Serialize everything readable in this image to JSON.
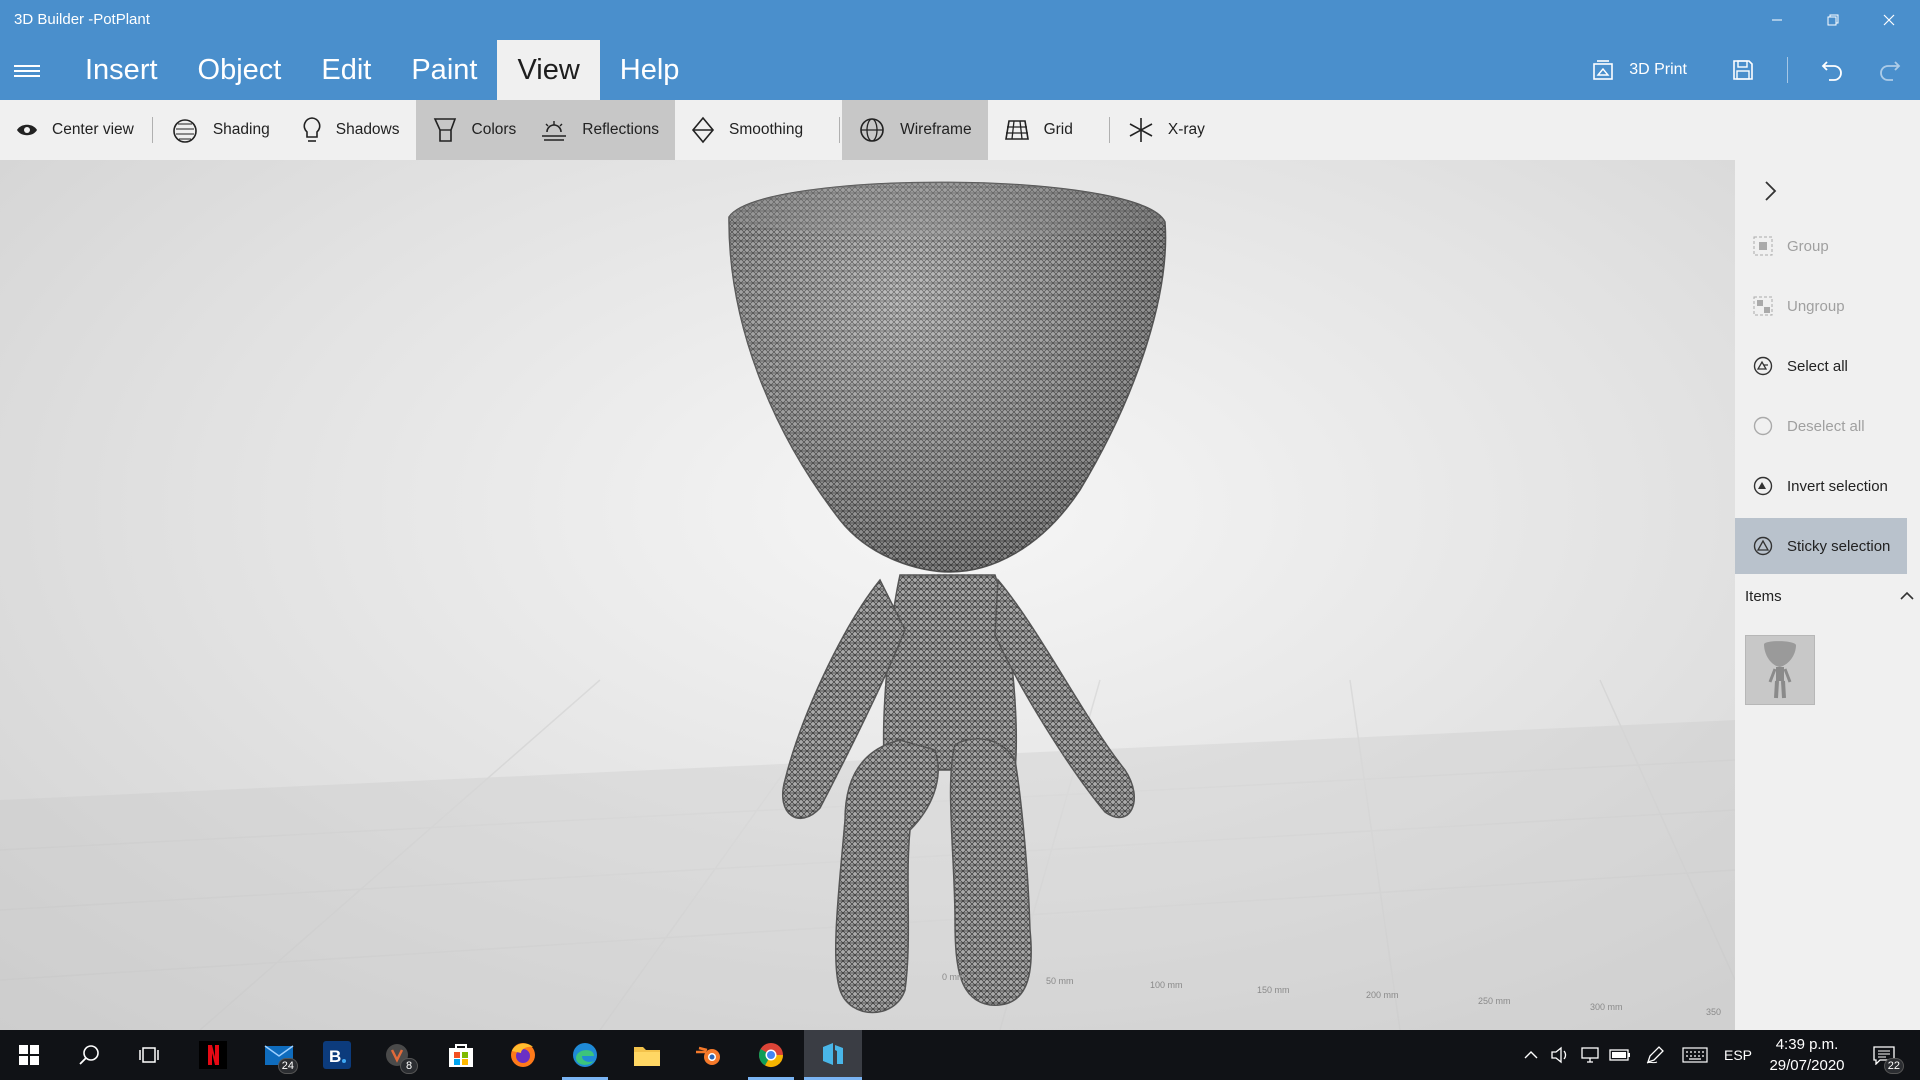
{
  "app": {
    "title": "3D Builder -PotPlant"
  },
  "menu": [
    {
      "label": "Insert"
    },
    {
      "label": "Object"
    },
    {
      "label": "Edit"
    },
    {
      "label": "Paint"
    },
    {
      "label": "View",
      "active": true
    },
    {
      "label": "Help"
    }
  ],
  "toolbar": {
    "print_label": "3D Print",
    "icons": [
      "print-3d-icon",
      "save-icon",
      "undo-icon",
      "redo-icon"
    ]
  },
  "ribbon": [
    {
      "label": "Center view",
      "icon": "eye-icon",
      "active": false
    },
    {
      "label": "Shading",
      "icon": "shading-icon",
      "active": false
    },
    {
      "label": "Shadows",
      "icon": "bulb-icon",
      "active": false
    },
    {
      "label": "Colors",
      "icon": "paint-bucket-icon",
      "active": true
    },
    {
      "label": "Reflections",
      "icon": "reflection-icon",
      "active": true
    },
    {
      "label": "Smoothing",
      "icon": "smoothing-icon",
      "active": false
    },
    {
      "label": "Wireframe",
      "icon": "globe-icon",
      "active": true
    },
    {
      "label": "Grid",
      "icon": "grid-icon",
      "active": false
    },
    {
      "label": "X-ray",
      "icon": "xray-icon",
      "active": false
    }
  ],
  "panel": {
    "actions": [
      {
        "label": "Group",
        "enabled": false
      },
      {
        "label": "Ungroup",
        "enabled": false
      },
      {
        "label": "Select all",
        "enabled": true
      },
      {
        "label": "Deselect all",
        "enabled": false
      },
      {
        "label": "Invert selection",
        "enabled": true
      },
      {
        "label": "Sticky selection",
        "enabled": true,
        "active": true
      }
    ],
    "items_label": "Items"
  },
  "scene": {
    "ruler": [
      "0 mm",
      "50 mm",
      "100 mm",
      "150 mm",
      "200 mm",
      "250 mm",
      "300 mm",
      "350"
    ]
  },
  "taskbar": {
    "apps": [
      "start-icon",
      "search-icon",
      "task-view-icon",
      "netflix-icon",
      "mail-icon",
      "booking-icon",
      "app-8-icon",
      "store-icon",
      "firefox-icon",
      "edge-icon",
      "file-explorer-icon",
      "blender-icon",
      "chrome-icon",
      "3d-builder-icon"
    ],
    "mail_badge": "24",
    "app_badge": "8",
    "language": "ESP",
    "time": "4:39 p.m.",
    "date": "29/07/2020",
    "notifications": "22"
  }
}
